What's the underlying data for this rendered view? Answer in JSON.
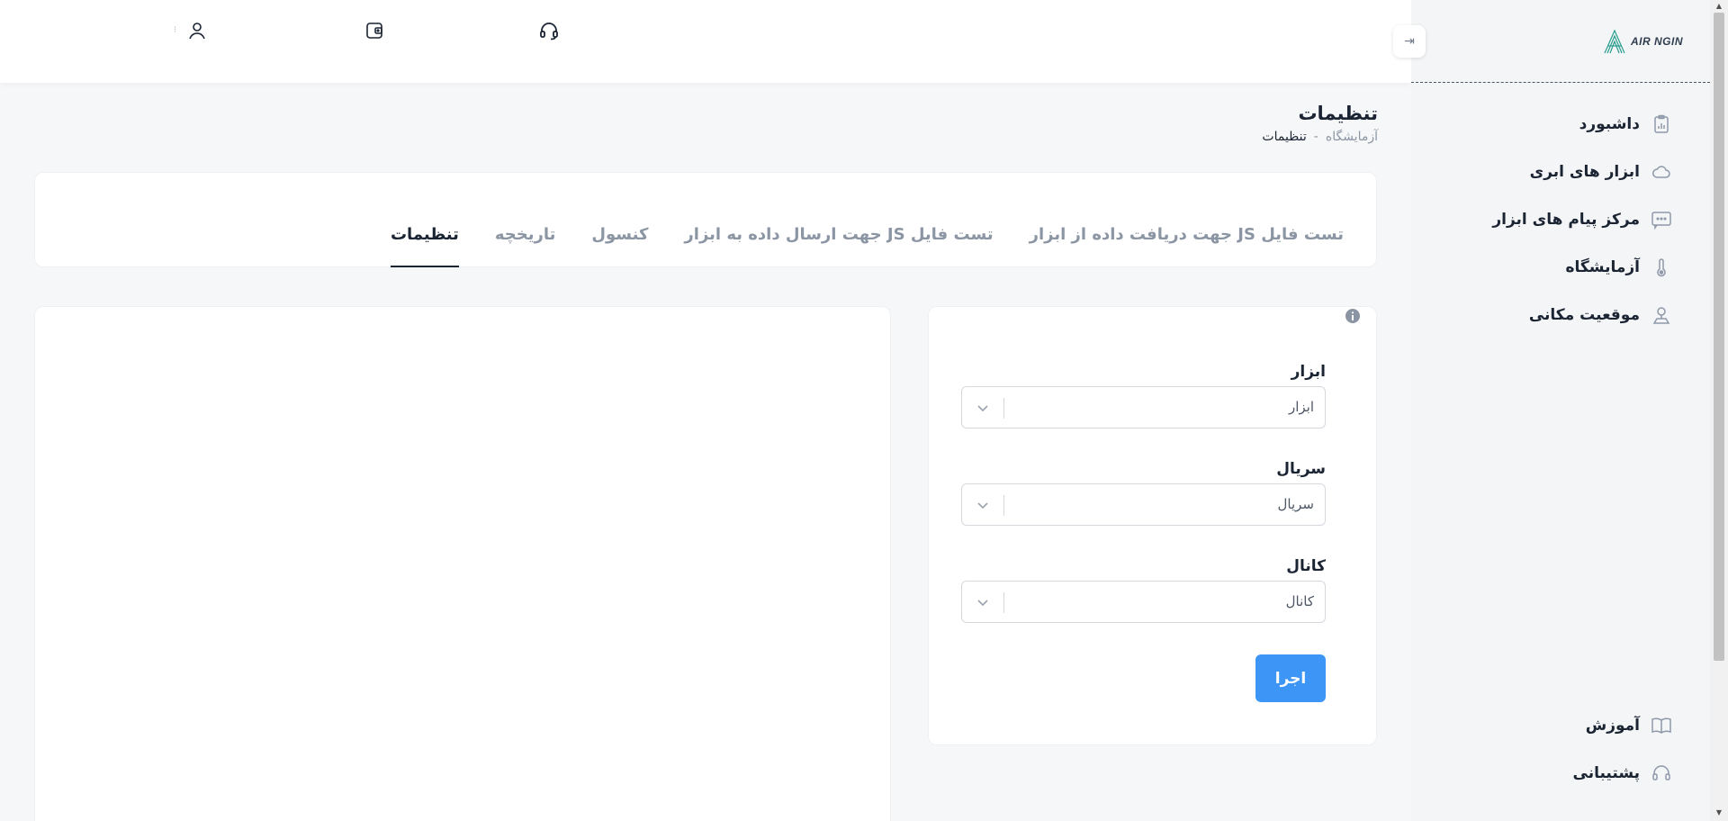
{
  "brand": {
    "logo_text": "AIR NGIN"
  },
  "sidebar": {
    "items": [
      {
        "label": "داشبورد",
        "icon": "clipboard-chart-icon"
      },
      {
        "label": "ابزار های ابری",
        "icon": "cloud-icon"
      },
      {
        "label": "مرکز پیام های ابزار",
        "icon": "message-icon"
      },
      {
        "label": "آزمایشگاه",
        "icon": "thermometer-icon"
      },
      {
        "label": "موقعیت مکانی",
        "icon": "location-pin-icon"
      }
    ],
    "bottom_items": [
      {
        "label": "آموزش",
        "icon": "book-icon"
      },
      {
        "label": "پشتیبانی",
        "icon": "headset-icon"
      }
    ]
  },
  "page": {
    "title": "تنظیمات",
    "breadcrumb": {
      "parent": "آزمایشگاه",
      "separator": "-",
      "current": "تنظیمات"
    }
  },
  "tabs": [
    {
      "label": "تست فایل JS جهت دریافت داده از ابزار",
      "active": false
    },
    {
      "label": "تست فایل JS جهت ارسال داده به ابزار",
      "active": false
    },
    {
      "label": "کنسول",
      "active": false
    },
    {
      "label": "تاریخچه",
      "active": false
    },
    {
      "label": "تنظیمات",
      "active": true
    }
  ],
  "form": {
    "tool": {
      "label": "ابزار",
      "placeholder": "ابزار"
    },
    "serial": {
      "label": "سریال",
      "placeholder": "سریال"
    },
    "channel": {
      "label": "کانال",
      "placeholder": "کانال"
    },
    "run_label": "اجرا"
  },
  "colors": {
    "accent": "#3d96f6",
    "text": "#1b2433",
    "muted": "#8b95a3",
    "sidebar_bg": "#f4f5f6"
  }
}
